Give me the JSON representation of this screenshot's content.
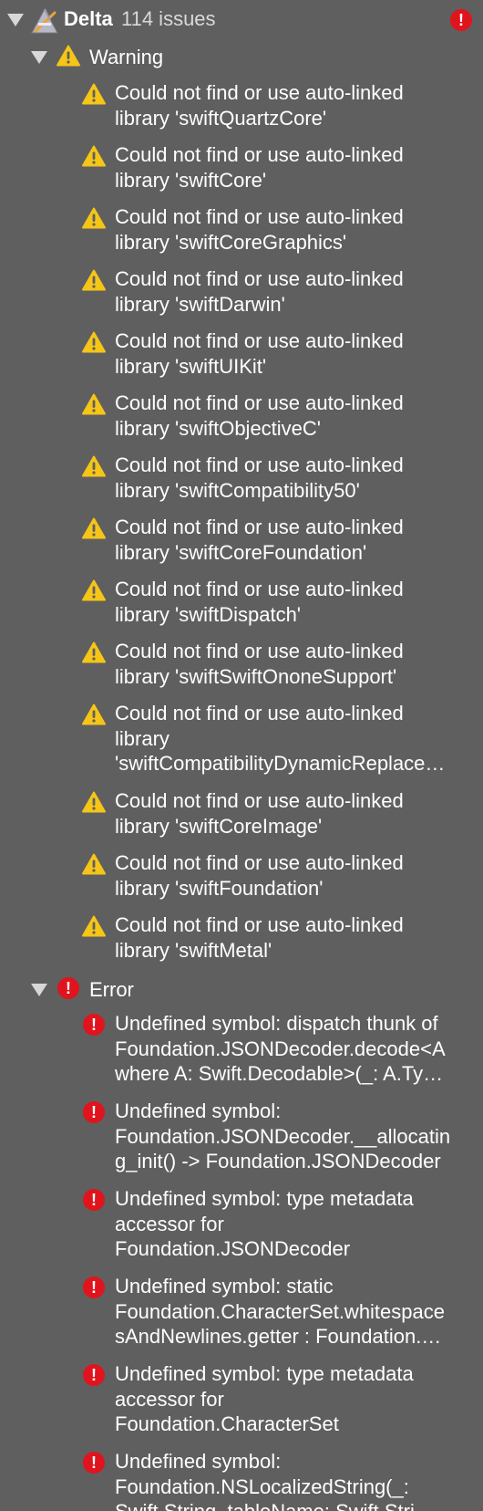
{
  "project": {
    "name": "Delta",
    "issue_count_label": "114 issues",
    "error_badge": "!"
  },
  "groups": {
    "warning": {
      "label": "Warning"
    },
    "error": {
      "label": "Error"
    }
  },
  "colors": {
    "background": "#5f5f5f",
    "warning_yellow": "#f5c518",
    "error_red": "#e0141d",
    "text": "#ffffff"
  },
  "warnings": [
    [
      "Could not find or use auto-linked",
      "library 'swiftQuartzCore'"
    ],
    [
      "Could not find or use auto-linked",
      "library 'swiftCore'"
    ],
    [
      "Could not find or use auto-linked",
      "library 'swiftCoreGraphics'"
    ],
    [
      "Could not find or use auto-linked",
      "library 'swiftDarwin'"
    ],
    [
      "Could not find or use auto-linked",
      "library 'swiftUIKit'"
    ],
    [
      "Could not find or use auto-linked",
      "library 'swiftObjectiveC'"
    ],
    [
      "Could not find or use auto-linked",
      "library 'swiftCompatibility50'"
    ],
    [
      "Could not find or use auto-linked",
      "library 'swiftCoreFoundation'"
    ],
    [
      "Could not find or use auto-linked",
      "library 'swiftDispatch'"
    ],
    [
      "Could not find or use auto-linked",
      "library 'swiftSwiftOnoneSupport'"
    ],
    [
      "Could not find or use auto-linked",
      "library",
      "'swiftCompatibilityDynamicReplace…"
    ],
    [
      "Could not find or use auto-linked",
      "library 'swiftCoreImage'"
    ],
    [
      "Could not find or use auto-linked",
      "library 'swiftFoundation'"
    ],
    [
      "Could not find or use auto-linked",
      "library 'swiftMetal'"
    ]
  ],
  "errors": [
    [
      "Undefined symbol: dispatch thunk of",
      "Foundation.JSONDecoder.decode<A",
      "where A: Swift.Decodable>(_: A.Ty…"
    ],
    [
      "Undefined symbol:",
      "Foundation.JSONDecoder.__allocatin",
      "g_init() -> Foundation.JSONDecoder"
    ],
    [
      "Undefined symbol: type metadata",
      "accessor for",
      "Foundation.JSONDecoder"
    ],
    [
      "Undefined symbol: static",
      "Foundation.CharacterSet.whitespace",
      "sAndNewlines.getter : Foundation.…"
    ],
    [
      "Undefined symbol: type metadata",
      "accessor for",
      "Foundation.CharacterSet"
    ],
    [
      "Undefined symbol:",
      "Foundation.NSLocalizedString(_:",
      "Swift.String, tableName: Swift.Stri…"
    ]
  ]
}
